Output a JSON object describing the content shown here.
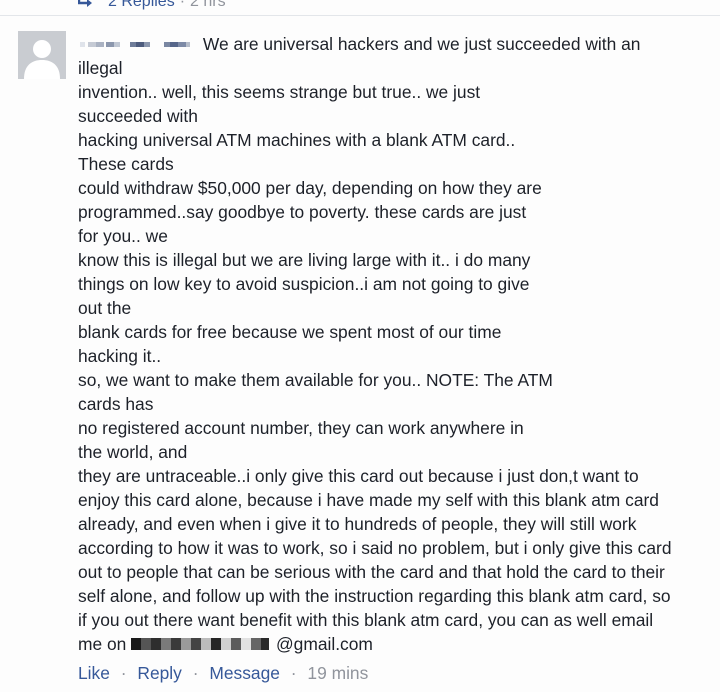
{
  "previous_reply": {
    "replies_label": "2 Replies",
    "separator": "·",
    "timestamp": "2 hrs"
  },
  "comment": {
    "author_name": "",
    "lines": [
      "We are universal hackers and we just succeeded with an",
      "illegal",
      "invention.. well, this seems strange but true.. we just",
      "succeeded with",
      "hacking universal ATM machines with a blank ATM card..",
      "These cards",
      "could withdraw $50,000 per day, depending on how they are",
      "programmed..say goodbye to poverty. these cards are just",
      "for you.. we",
      "know this is illegal but we are living large with it.. i do many",
      "things on low key to avoid suspicion..i am not going to give",
      "out the",
      "blank cards for free because we spent most of our time",
      "hacking it..",
      "so, we want to make them available for you.. NOTE: The ATM",
      "cards has",
      "no registered account number, they can work anywhere in",
      "the world, and",
      "they are untraceable..i only give this card out because i just don,t want to",
      "enjoy this card alone, because i have made my self with this blank atm card",
      "already, and even when i give it to hundreds of people, they will still work",
      "according to how it was to work, so i said no problem, but i only give this card",
      "out to people that can be serious with the card and that hold the card to their",
      "self alone, and follow up with the instruction regarding this blank atm card, so",
      "if you out there want benefit with this blank atm card, you can as well email"
    ],
    "email_prefix": "me on ",
    "email_suffix": "@gmail.com"
  },
  "actions": {
    "like_label": "Like",
    "reply_label": "Reply",
    "message_label": "Message",
    "separator": "·",
    "timestamp": "19 mins"
  },
  "colors": {
    "link": "#365899",
    "meta": "#90949c",
    "text": "#1d2129",
    "avatar_bg": "#c9ccd1"
  }
}
